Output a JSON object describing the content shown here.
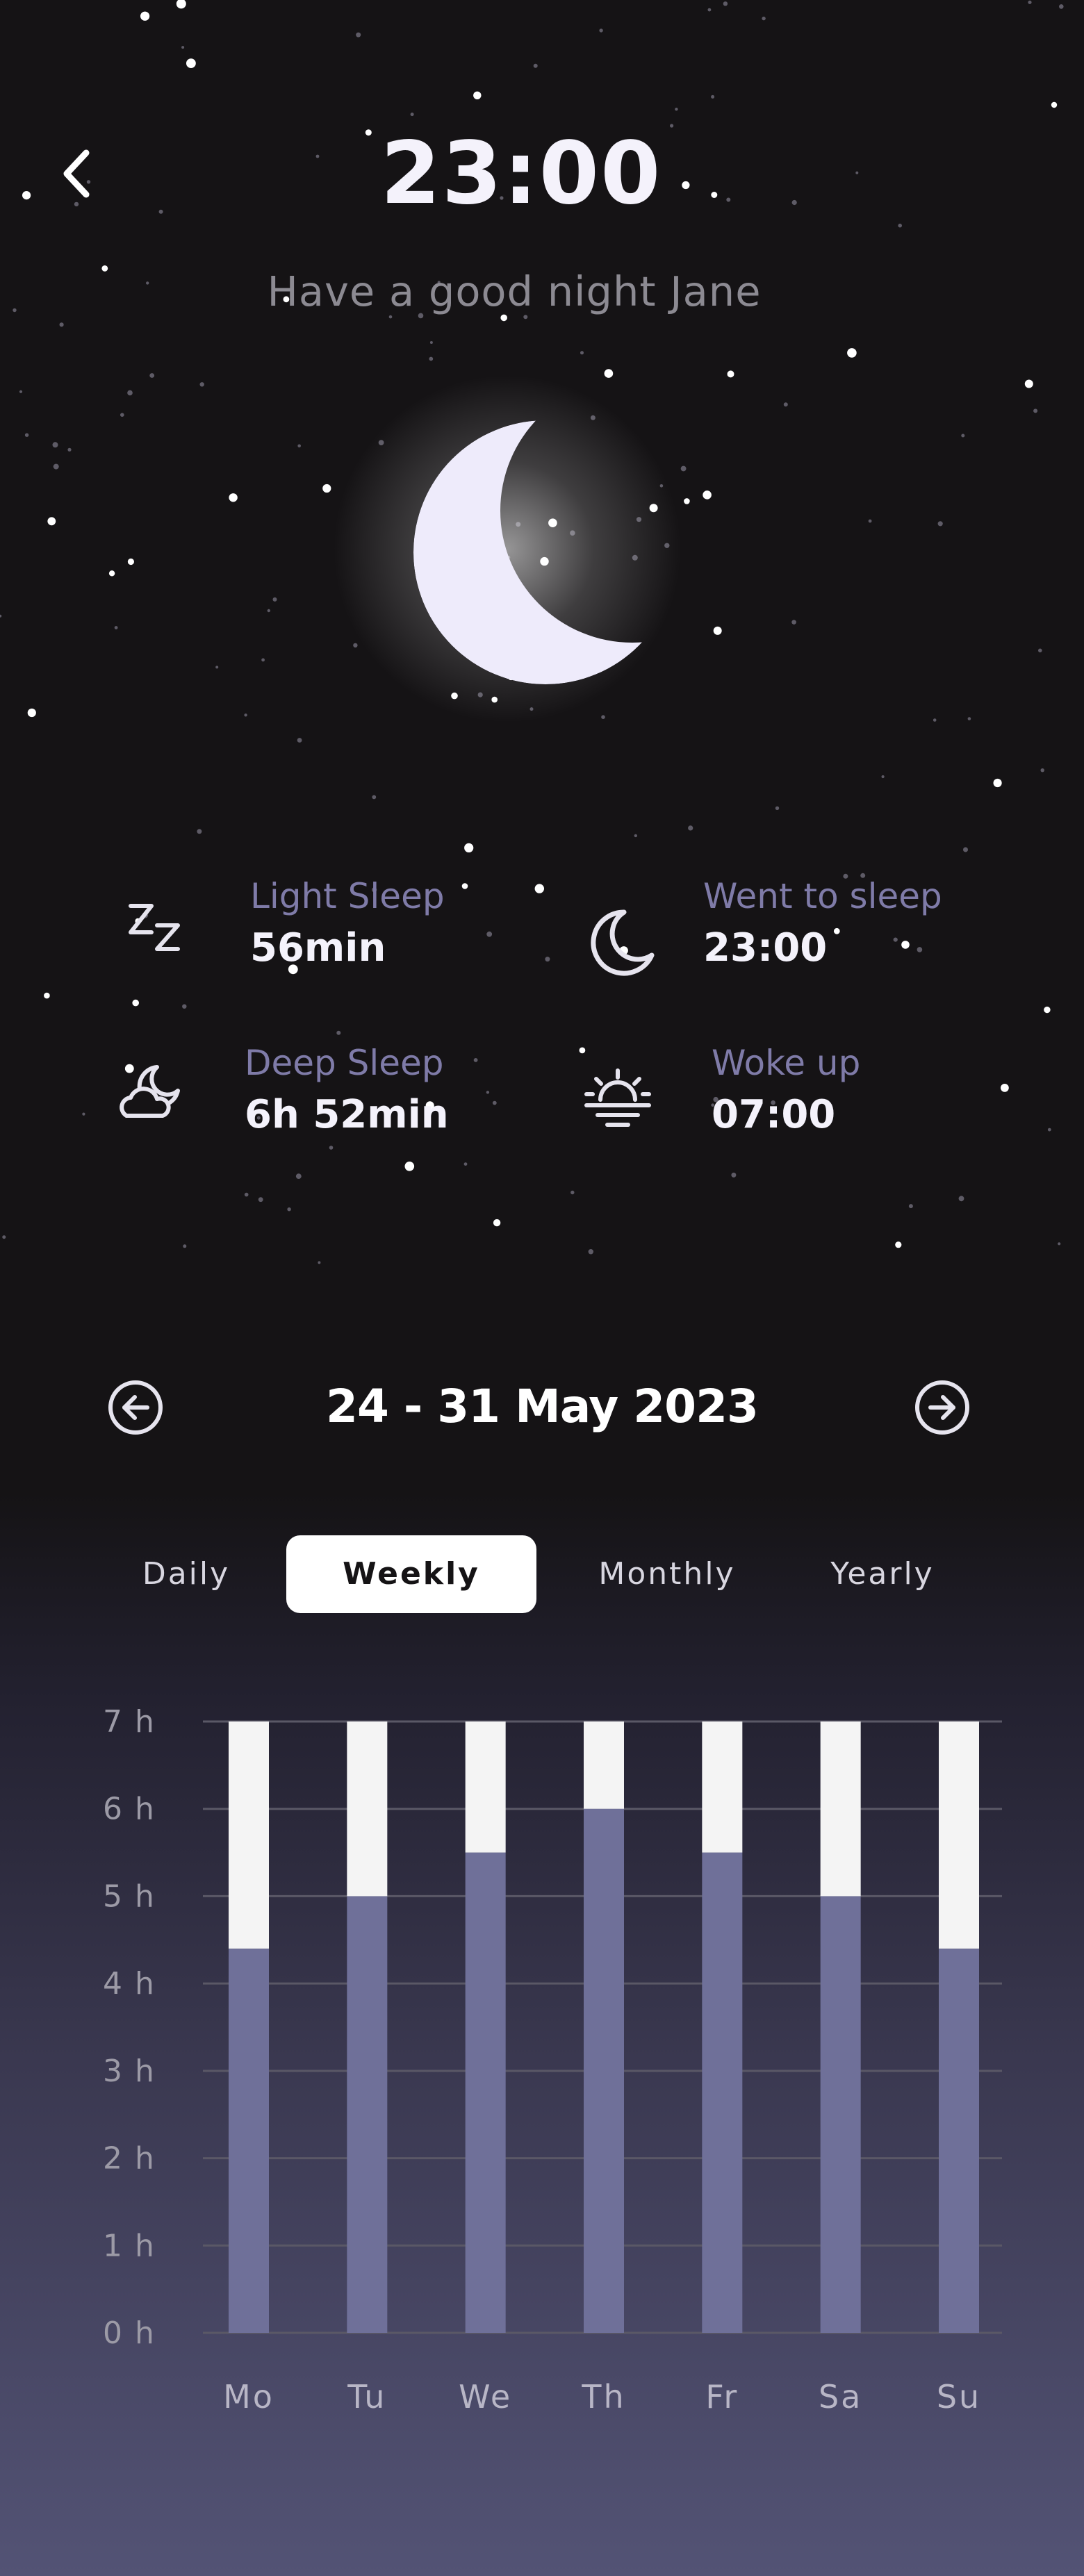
{
  "header": {
    "time": "23:00",
    "greeting": "Have a good night  Jane"
  },
  "icons": {
    "back": "chevron-left-icon",
    "light_sleep": "zzz-icon",
    "deep_sleep": "moon-cloud-icon",
    "went_to_sleep": "crescent-moon-icon",
    "woke_up": "sunrise-icon",
    "prev": "arrow-left-circle-icon",
    "next": "arrow-right-circle-icon"
  },
  "stats": {
    "light_sleep": {
      "label": "Light Sleep",
      "value": "56min"
    },
    "deep_sleep": {
      "label": "Deep Sleep",
      "value": "6h 52min"
    },
    "went_to_sleep": {
      "label": "Went to sleep",
      "value": "23:00"
    },
    "woke_up": {
      "label": "Woke up",
      "value": "07:00"
    }
  },
  "range": {
    "label": "24 - 31 May 2023"
  },
  "tabs": {
    "daily": "Daily",
    "weekly": "Weekly",
    "monthly": "Monthly",
    "yearly": "Yearly",
    "selected": "Weekly"
  },
  "colors": {
    "deep": "#6f7099",
    "light": "#f4f4f4",
    "accent_label": "#7f7ba8"
  },
  "chart_data": {
    "type": "bar",
    "stacked": true,
    "categories": [
      "Mo",
      "Tu",
      "We",
      "Th",
      "Fr",
      "Sa",
      "Su"
    ],
    "series": [
      {
        "values": [
          4.4,
          5.0,
          5.5,
          6.0,
          5.5,
          5.0,
          4.4
        ],
        "color": "#6f7099"
      },
      {
        "values": [
          2.6,
          2.0,
          1.5,
          1.0,
          1.5,
          2.0,
          2.6
        ],
        "color": "#f4f4f4"
      }
    ],
    "yticks": [
      "0 h",
      "1 h",
      "2 h",
      "3 h",
      "4 h",
      "5 h",
      "6 h",
      "7 h"
    ],
    "ylim": [
      0,
      7
    ],
    "grid": true
  }
}
